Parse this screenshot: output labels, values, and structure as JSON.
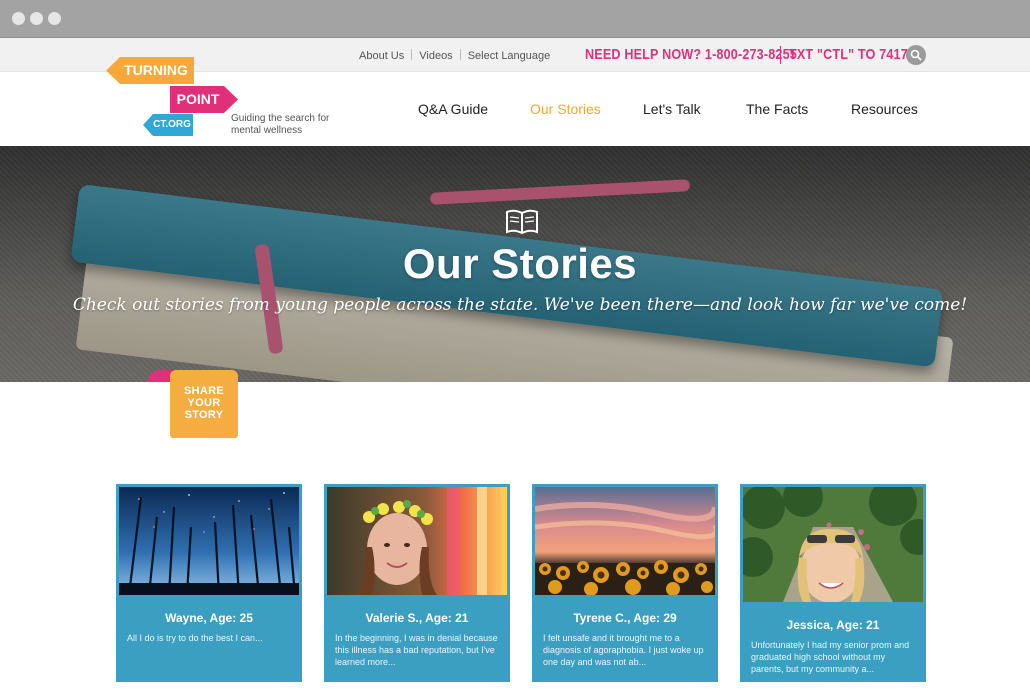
{
  "window": {
    "controls": [
      "close",
      "minimize",
      "maximize"
    ]
  },
  "utility_nav": {
    "about": "About Us",
    "videos": "Videos",
    "language": "Select Language"
  },
  "helpline": {
    "call": "NEED HELP NOW? 1-800-273-8255",
    "text": "TXT \"CTL\" TO 741741"
  },
  "logo": {
    "line1": "TURNING",
    "line2": "POINT",
    "line3": "CT.ORG",
    "tagline": "Guiding the search for mental wellness"
  },
  "main_nav": [
    {
      "label": "Q&A Guide",
      "active": false
    },
    {
      "label": "Our Stories",
      "active": true
    },
    {
      "label": "Let's Talk",
      "active": false
    },
    {
      "label": "The Facts",
      "active": false
    },
    {
      "label": "Resources",
      "active": false
    }
  ],
  "hero": {
    "icon": "open-book-icon",
    "title": "Our Stories",
    "subtitle": "Check out stories from young people across the state. We've been there—and look how far we've come!"
  },
  "share_badge": {
    "line1": "SHARE",
    "line2": "YOUR",
    "line3": "STORY"
  },
  "stories": [
    {
      "name": "Wayne, Age: 25",
      "excerpt": "All I do is try to do the best I can...",
      "photo": "night-forest-stars"
    },
    {
      "name": "Valerie S., Age: 21",
      "excerpt": "In the beginning, I was in denial because this illness has a bad reputation, but I've learned more...",
      "photo": "girl-flower-crown"
    },
    {
      "name": "Tyrene C., Age: 29",
      "excerpt": "I felt unsafe and it brought me to a diagnosis of agoraphobia. I just woke up one day and was not ab...",
      "photo": "sunflower-sunset"
    },
    {
      "name": "Jessica, Age: 21",
      "excerpt": "Unfortunately I had my senior prom and graduated high school without my parents, but my community a...",
      "photo": "woman-selfie-park"
    }
  ],
  "colors": {
    "pink": "#e0307a",
    "orange": "#f7a83b",
    "blue": "#2fa8d6",
    "card_blue": "#3a9fc0",
    "active_nav": "#f0a830"
  }
}
